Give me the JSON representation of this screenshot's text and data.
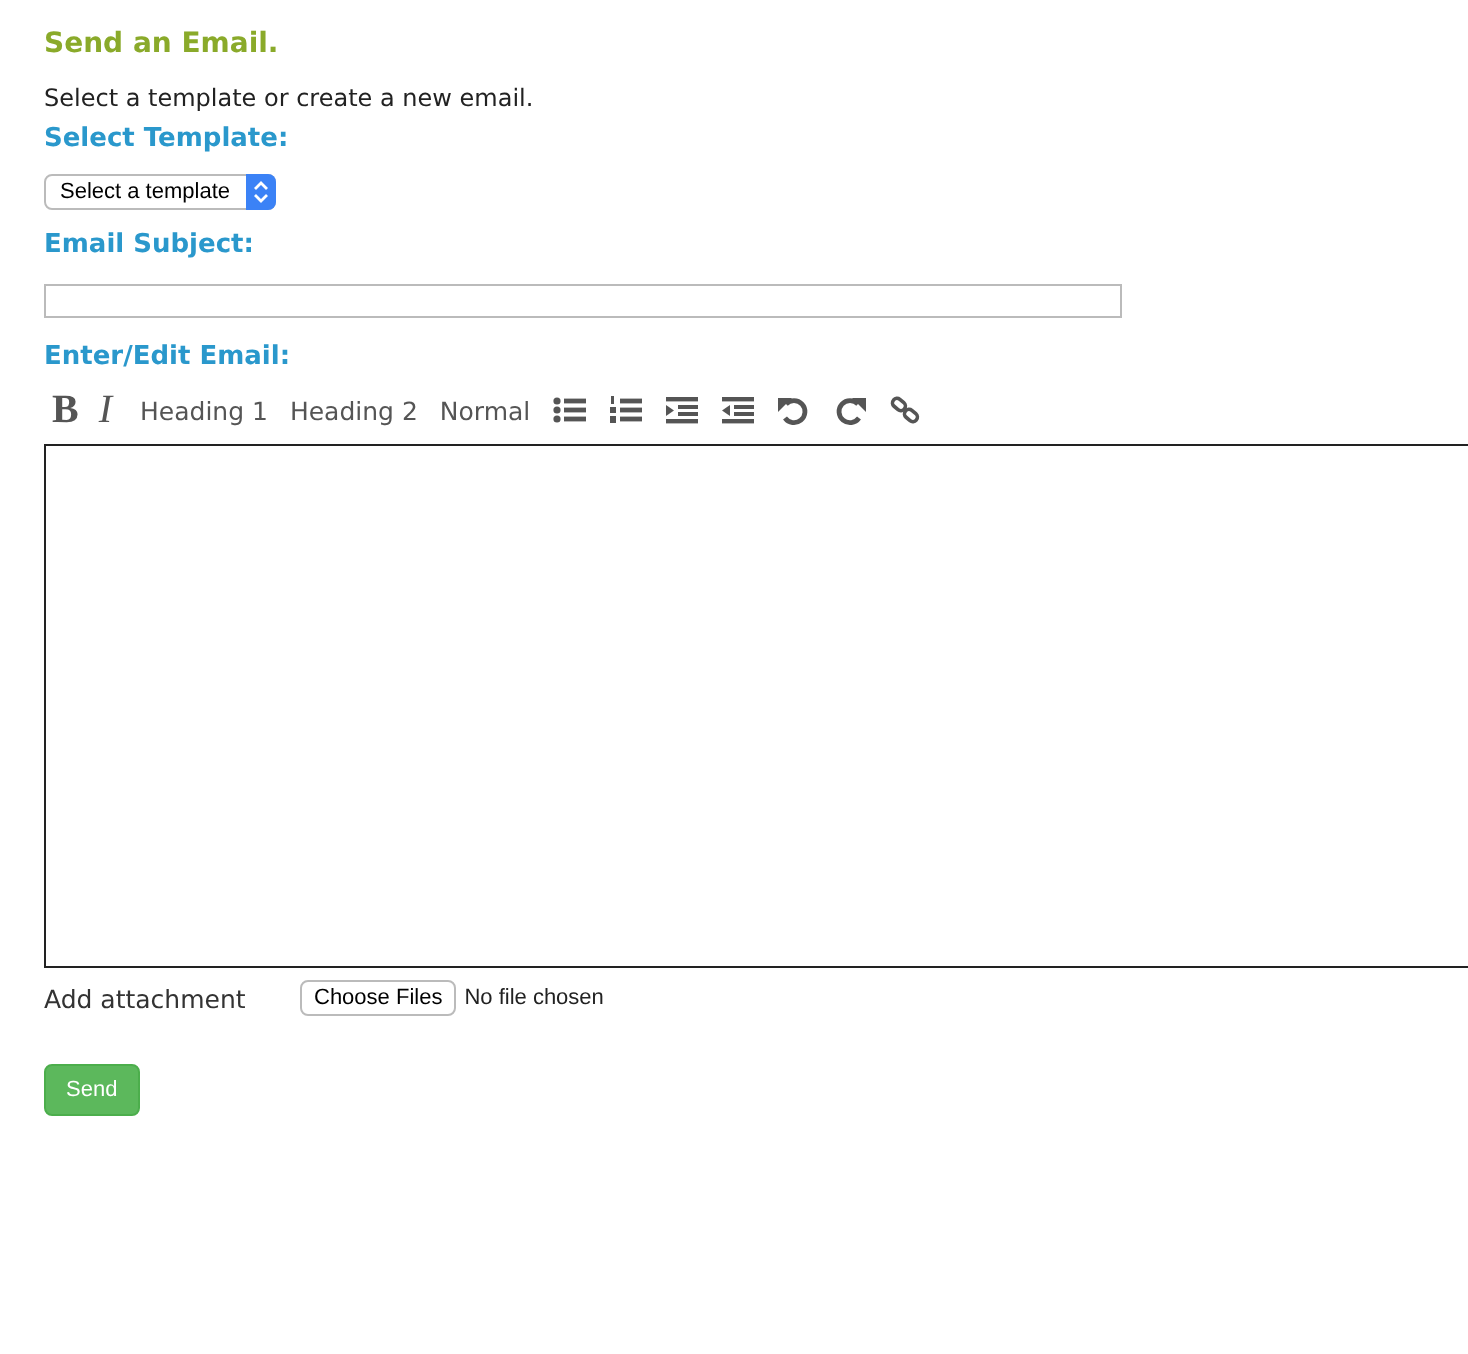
{
  "title": "Send an Email.",
  "intro": "Select a template or create a new email.",
  "template": {
    "label": "Select Template:",
    "value": "Select a template"
  },
  "subject": {
    "label": "Email Subject:"
  },
  "editor": {
    "label": "Enter/Edit Email:",
    "toolbar": [
      {
        "kind": "bold",
        "text": "B"
      },
      {
        "kind": "italic",
        "text": "I"
      },
      {
        "kind": "text",
        "text": "Heading 1"
      },
      {
        "kind": "text",
        "text": "Heading 2"
      },
      {
        "kind": "text",
        "text": "Normal"
      },
      {
        "kind": "bullet-list"
      },
      {
        "kind": "numbered-list"
      },
      {
        "kind": "indent"
      },
      {
        "kind": "outdent"
      },
      {
        "kind": "undo"
      },
      {
        "kind": "redo"
      },
      {
        "kind": "link"
      }
    ]
  },
  "attachment": {
    "label": "Add attachment",
    "button": "Choose Files",
    "status": "No file chosen"
  },
  "send": "Send"
}
